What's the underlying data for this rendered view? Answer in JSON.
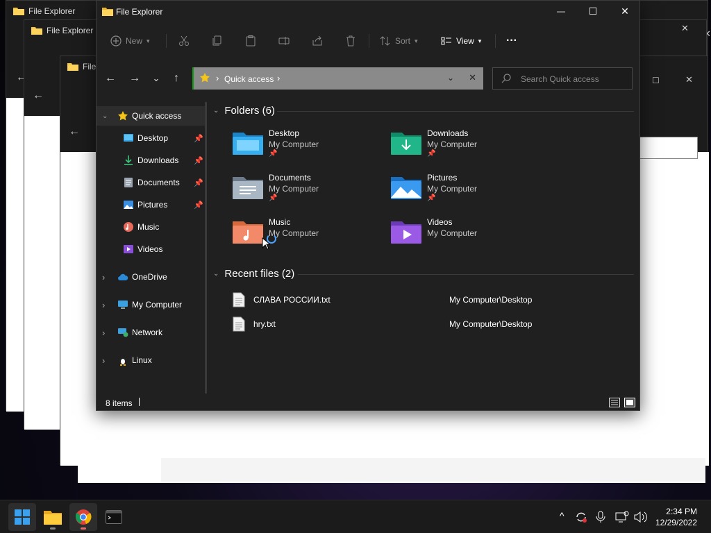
{
  "background_windows": [
    {
      "title": "File Explorer"
    },
    {
      "title": "File Explorer"
    },
    {
      "title": "File E"
    }
  ],
  "window": {
    "title": "File Explorer",
    "minimize": "—",
    "maximize": "☐",
    "close": "✕"
  },
  "toolbar": {
    "new_label": "New",
    "sort_label": "Sort",
    "view_label": "View",
    "more_label": "···"
  },
  "nav": {
    "back": "←",
    "forward": "→",
    "recent": "⌄",
    "up": "↑"
  },
  "address": {
    "separator": "›",
    "crumb": "Quick access",
    "trail": "›",
    "dropdown": "⌄",
    "clear": "✕"
  },
  "search": {
    "placeholder": "Search Quick access"
  },
  "sidebar": {
    "items": [
      {
        "label": "Quick access",
        "chevron": "⌄",
        "pinned": ""
      },
      {
        "label": "Desktop",
        "pinned": "📌"
      },
      {
        "label": "Downloads",
        "pinned": "📌"
      },
      {
        "label": "Documents",
        "pinned": "📌"
      },
      {
        "label": "Pictures",
        "pinned": "📌"
      },
      {
        "label": "Music",
        "pinned": ""
      },
      {
        "label": "Videos",
        "pinned": ""
      },
      {
        "label": "OneDrive",
        "chevron": "›"
      },
      {
        "label": "My Computer",
        "chevron": "›"
      },
      {
        "label": "Network",
        "chevron": "›"
      },
      {
        "label": "Linux",
        "chevron": "›"
      }
    ]
  },
  "folders_section": {
    "chevron": "⌄",
    "title": "Folders (6)",
    "items": [
      {
        "name": "Desktop",
        "location": "My Computer",
        "pin": "📌"
      },
      {
        "name": "Downloads",
        "location": "My Computer",
        "pin": "📌"
      },
      {
        "name": "Documents",
        "location": "My Computer",
        "pin": "📌"
      },
      {
        "name": "Pictures",
        "location": "My Computer",
        "pin": "📌"
      },
      {
        "name": "Music",
        "location": "My Computer",
        "pin": ""
      },
      {
        "name": "Videos",
        "location": "My Computer",
        "pin": ""
      }
    ]
  },
  "recent_section": {
    "chevron": "⌄",
    "title": "Recent files (2)",
    "items": [
      {
        "name": "СЛАВА РОССИИ.txt",
        "path": "My Computer\\Desktop"
      },
      {
        "name": "hry.txt",
        "path": "My Computer\\Desktop"
      }
    ]
  },
  "status": {
    "count": "8 items"
  },
  "taskbar": {
    "tray_chevron": "^",
    "time": "2:34 PM",
    "date": "12/29/2022"
  },
  "colors": {
    "window_bg": "#202020",
    "address_bg": "#8a8a8a",
    "accent_blue": "#4aa3ff",
    "taskbar_bg": "#1b1b1b"
  }
}
